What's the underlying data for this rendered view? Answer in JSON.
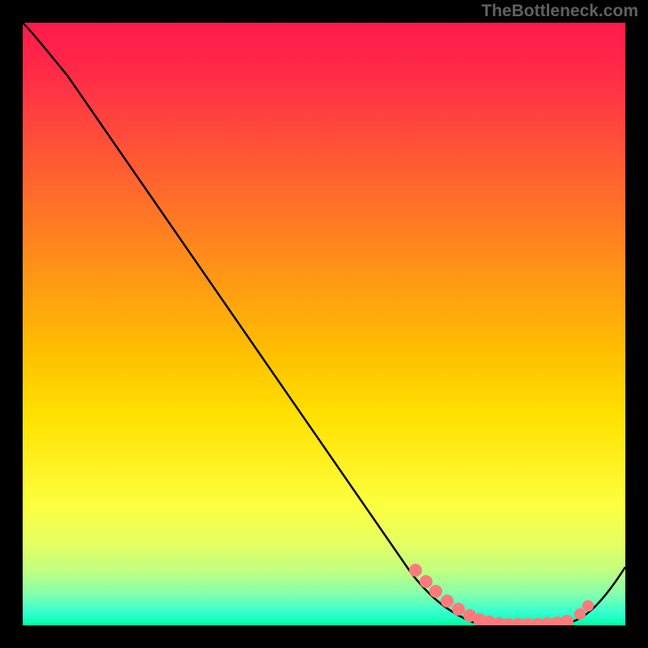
{
  "watermark": "TheBottleneck.com",
  "chart_data": {
    "type": "line",
    "title": "",
    "xlabel": "",
    "ylabel": "",
    "xlim": [
      0,
      100
    ],
    "ylim": [
      0,
      100
    ],
    "series": [
      {
        "name": "curve",
        "x": [
          0,
          3,
          8,
          15,
          25,
          35,
          45,
          55,
          65,
          70,
          74,
          78,
          82,
          86,
          90,
          94,
          100
        ],
        "y": [
          100,
          97,
          92,
          84,
          71,
          58,
          45,
          32,
          19,
          12,
          7,
          3,
          1,
          0,
          0,
          2,
          10
        ]
      }
    ],
    "scatter_overlay": {
      "name": "highlight-points",
      "color": "#ff7a7a",
      "x": [
        65,
        67,
        69,
        73,
        75,
        76,
        77,
        78,
        79,
        80,
        81,
        83,
        85,
        87,
        89,
        90,
        92,
        93
      ],
      "y": [
        10,
        8,
        6,
        3,
        2,
        1.5,
        1.2,
        1,
        0.8,
        0.7,
        0.6,
        0.5,
        0.5,
        0.5,
        0.5,
        1,
        2,
        3
      ]
    },
    "gradient_stops": [
      {
        "pos": 0,
        "color": "#ff1a4d"
      },
      {
        "pos": 50,
        "color": "#ffc000"
      },
      {
        "pos": 80,
        "color": "#fcff40"
      },
      {
        "pos": 100,
        "color": "#00ffa0"
      }
    ]
  }
}
